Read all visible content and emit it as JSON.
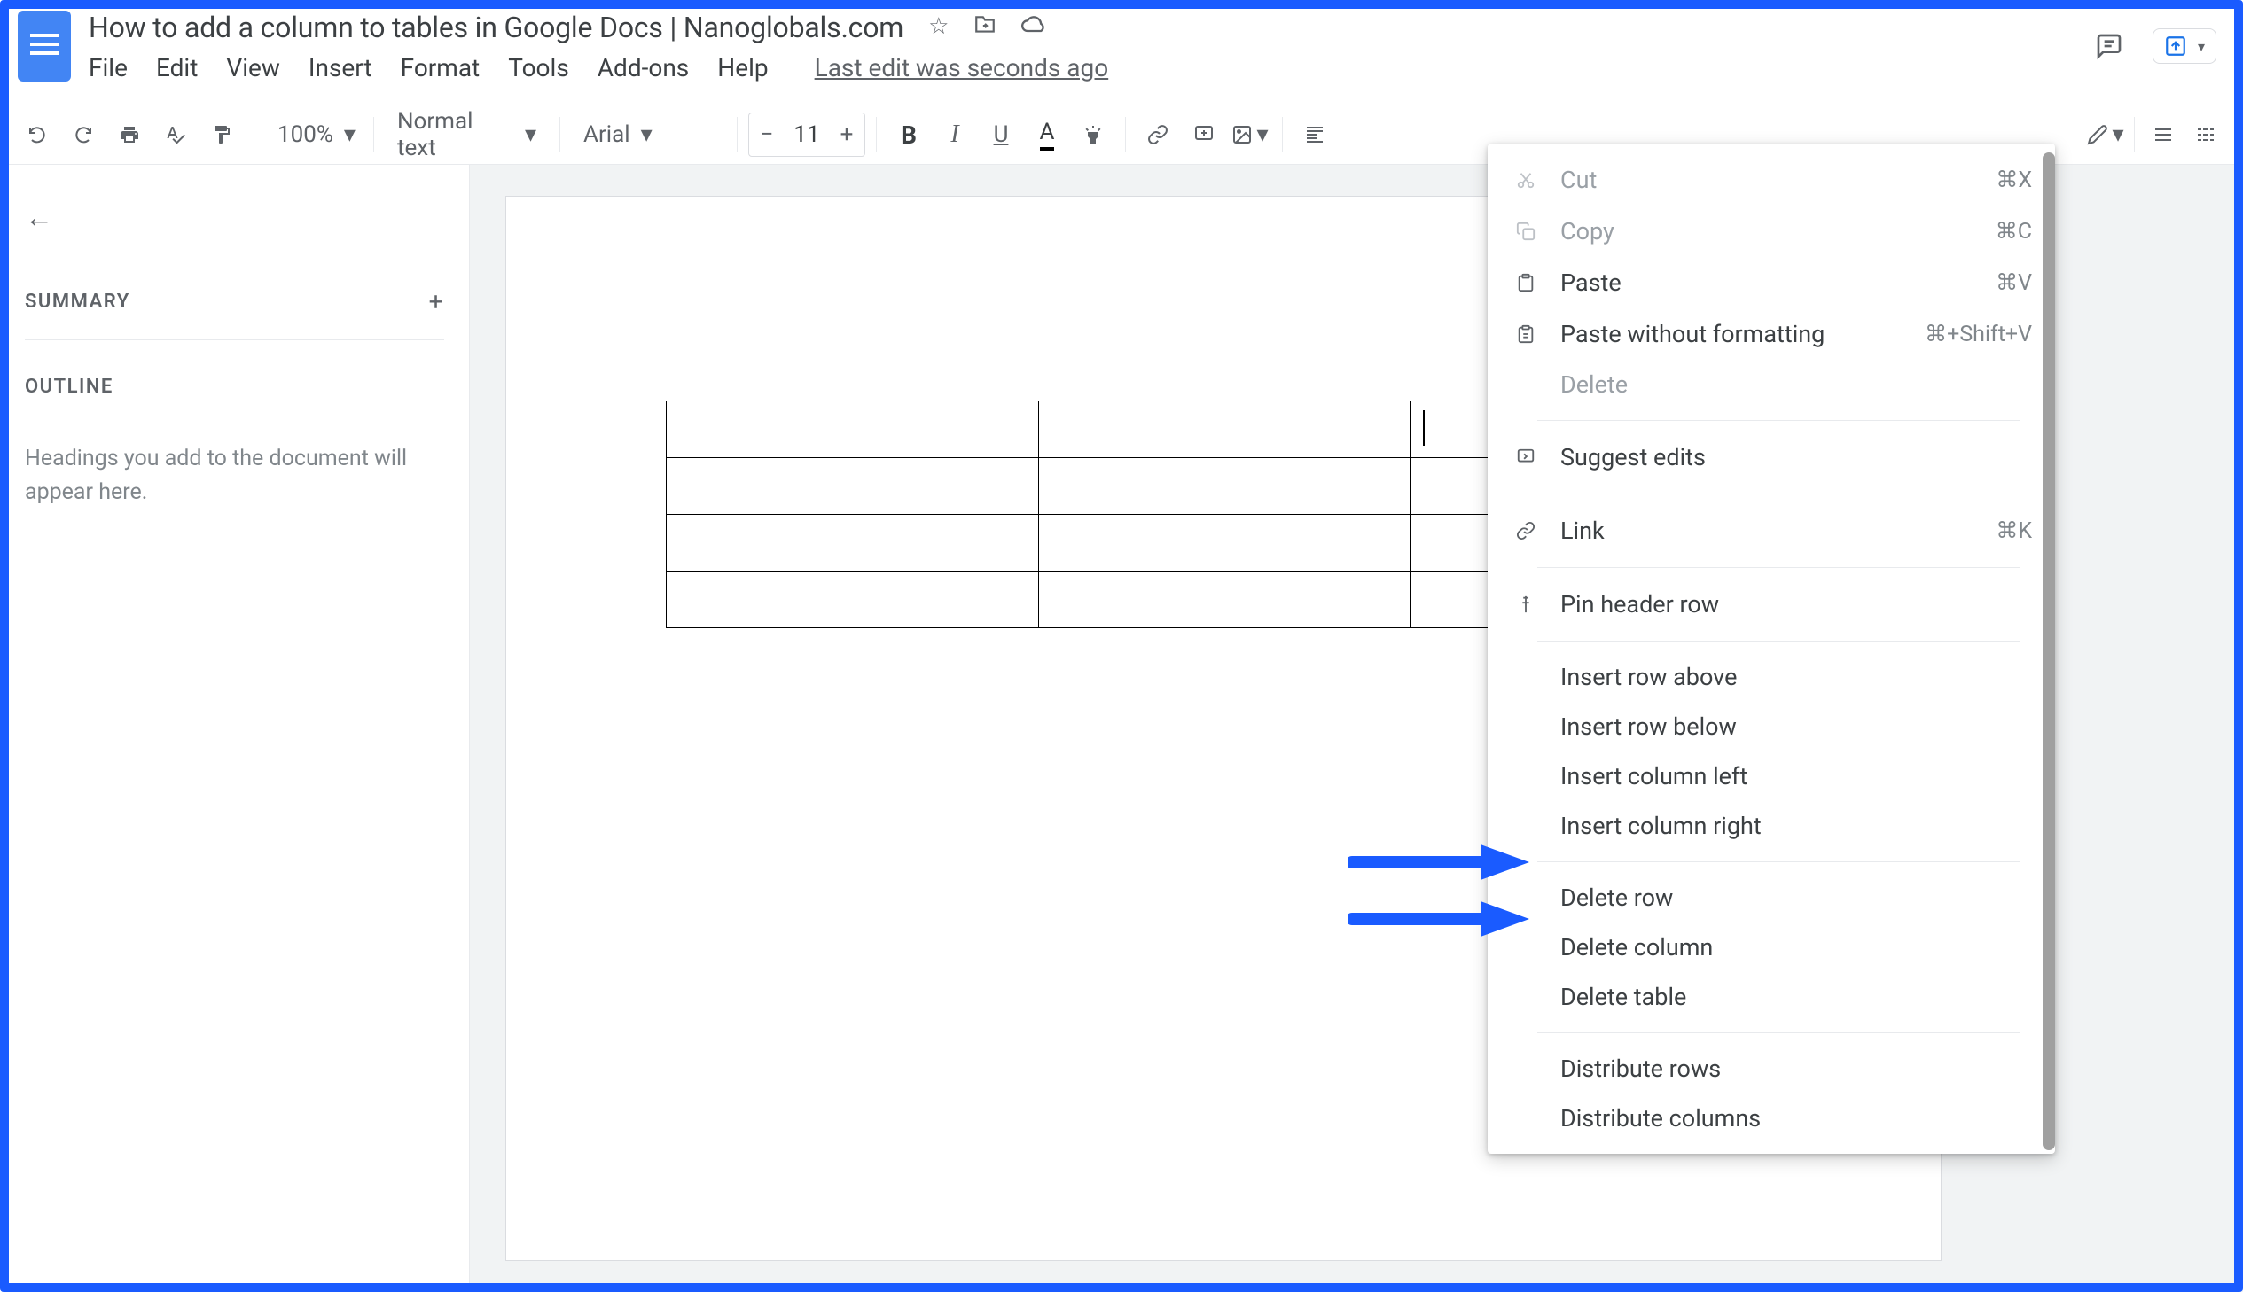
{
  "document": {
    "title": "How to add a column to tables in Google Docs | Nanoglobals.com",
    "last_edit": "Last edit was seconds ago"
  },
  "menu": {
    "file": "File",
    "edit": "Edit",
    "view": "View",
    "insert": "Insert",
    "format": "Format",
    "tools": "Tools",
    "addons": "Add-ons",
    "help": "Help"
  },
  "toolbar": {
    "zoom": "100%",
    "style": "Normal text",
    "font": "Arial",
    "size": "11"
  },
  "sidebar": {
    "summary": "SUMMARY",
    "outline": "OUTLINE",
    "outline_placeholder": "Headings you add to the document will appear here."
  },
  "context_menu": {
    "cut": {
      "label": "Cut",
      "shortcut": "⌘X"
    },
    "copy": {
      "label": "Copy",
      "shortcut": "⌘C"
    },
    "paste": {
      "label": "Paste",
      "shortcut": "⌘V"
    },
    "paste_no_format": {
      "label": "Paste without formatting",
      "shortcut": "⌘+Shift+V"
    },
    "delete": {
      "label": "Delete"
    },
    "suggest_edits": {
      "label": "Suggest edits"
    },
    "link": {
      "label": "Link",
      "shortcut": "⌘K"
    },
    "pin_header": {
      "label": "Pin header row"
    },
    "insert_row_above": {
      "label": "Insert row above"
    },
    "insert_row_below": {
      "label": "Insert row below"
    },
    "insert_col_left": {
      "label": "Insert column left"
    },
    "insert_col_right": {
      "label": "Insert column right"
    },
    "delete_row": {
      "label": "Delete row"
    },
    "delete_column": {
      "label": "Delete column"
    },
    "delete_table": {
      "label": "Delete table"
    },
    "distribute_rows": {
      "label": "Distribute rows"
    },
    "distribute_columns": {
      "label": "Distribute columns"
    }
  }
}
